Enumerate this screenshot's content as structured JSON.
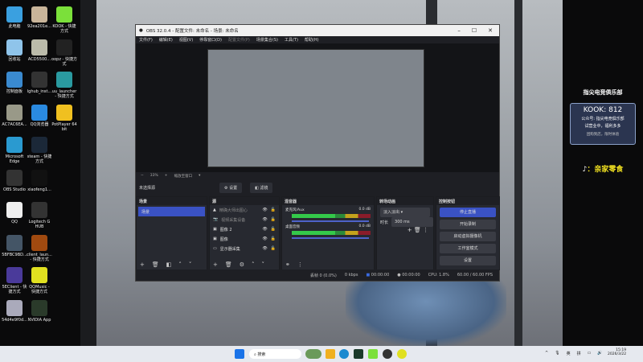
{
  "desktop": {
    "icons": [
      {
        "label": "此电脑",
        "color": "#3aa0e0"
      },
      {
        "label": "92ea201e...",
        "color": "#c9b59a"
      },
      {
        "label": "KOOK - 快捷方式",
        "color": "#7be03a"
      },
      {
        "label": "回收站",
        "color": "#8fc4ea"
      },
      {
        "label": "ACD5500...",
        "color": "#bba"
      },
      {
        "label": "oopz - 快捷方式",
        "color": "#222"
      },
      {
        "label": "控制面板",
        "color": "#3a8ad0"
      },
      {
        "label": "lghub_inst...",
        "color": "#333"
      },
      {
        "label": "uu_launcher - 快捷方式",
        "color": "#2a9aa0"
      },
      {
        "label": "AC7AC6EA...",
        "color": "#998"
      },
      {
        "label": "QQ浏览器",
        "color": "#2a8ae0"
      },
      {
        "label": "PotPlayer 64 bit",
        "color": "#f0c020"
      },
      {
        "label": "Microsoft Edge",
        "color": "#2a9ad0"
      },
      {
        "label": "steam - 快捷方式",
        "color": "#1b2838"
      },
      {
        "label": "",
        "color": ""
      },
      {
        "label": "OBS Studio",
        "color": "#333"
      },
      {
        "label": "xiaofeng1...",
        "color": "#111"
      },
      {
        "label": "",
        "color": ""
      },
      {
        "label": "QQ",
        "color": "#eee"
      },
      {
        "label": "Logitech G HUB",
        "color": "#333"
      },
      {
        "label": "",
        "color": ""
      },
      {
        "label": "5BFBC9BD...",
        "color": "#456"
      },
      {
        "label": "client_laun... - 快捷方式",
        "color": "#a04a10"
      },
      {
        "label": "",
        "color": ""
      },
      {
        "label": "5EClient - 快捷方式",
        "color": "#4a3a9a"
      },
      {
        "label": "QQMusic - 快捷方式",
        "color": "#e0e020"
      },
      {
        "label": "",
        "color": ""
      },
      {
        "label": "54d4e9f0d...",
        "color": "#aab"
      },
      {
        "label": "NVIDIA App",
        "color": "#2a3a2a"
      }
    ]
  },
  "promo": {
    "club": "指尖电竞俱乐部",
    "kook": "KOOK: 812",
    "wechat": "公众号: 指尖电竞俱乐部",
    "trial": "试营业中，福利多多",
    "deal": "团购到店，限时体验",
    "douyin": "：亲家零食"
  },
  "obs": {
    "title": "OBS 32.0.4 - 配置文件: 未命名 - 场景: 未命名",
    "menu": [
      "文件(F)",
      "编辑(E)",
      "视图(V)",
      "停靠窗口(D)",
      "配置文件(P)",
      "场景集合(S)",
      "工具(T)",
      "帮助(H)"
    ],
    "zoom": "33%",
    "zoom_mode": "缩放至窗口",
    "no_source": "未选择源",
    "settings_btn": "设置",
    "filters_btn": "滤镜",
    "scenes": {
      "title": "场景",
      "items": [
        "场景"
      ]
    },
    "sources": {
      "title": "源",
      "items": [
        "精确大师出图心",
        "视频采集设备",
        "图像 2",
        "图像",
        "显示器采集"
      ]
    },
    "mixer": {
      "title": "混音器",
      "channels": [
        {
          "name": "麦克风/Aux",
          "db": "0.0 dB"
        },
        {
          "name": "桌面音频",
          "db": "0.0 dB"
        }
      ]
    },
    "transitions": {
      "title": "转场动画",
      "type": "淡入淡出",
      "duration_label": "时长",
      "duration": "300 ms"
    },
    "controls": {
      "title": "控制按钮",
      "buttons": [
        "停止直播",
        "开始录制",
        "启动虚拟摄像机",
        "工作室模式",
        "设置"
      ]
    },
    "status": {
      "dropped": "丢帧 0 (0.0%)",
      "bitrate": "0 kbps",
      "stream_time": "00:00:00",
      "rec_time": "00:00:00",
      "cpu": "CPU: 1.8%",
      "fps": "60.00 / 60.00 FPS"
    },
    "accent": "#3a52c4"
  },
  "taskbar": {
    "search": "搜索",
    "ime1": "英",
    "ime2": "拼",
    "time": "15:19",
    "date": "2026/3/22"
  }
}
